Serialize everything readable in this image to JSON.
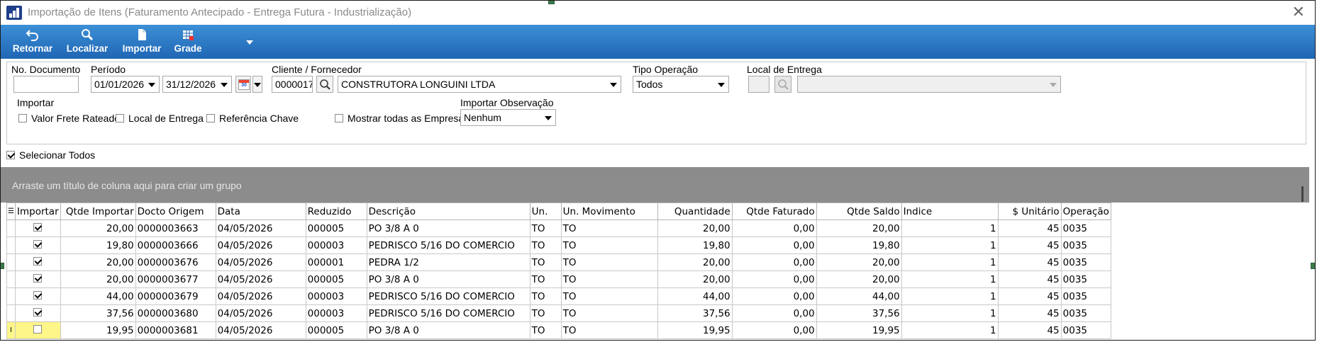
{
  "window": {
    "title": "Importação de Itens (Faturamento Antecipado - Entrega Futura - Industrialização)"
  },
  "toolbar": {
    "retornar": "Retornar",
    "localizar": "Localizar",
    "importar": "Importar",
    "grade": "Grade"
  },
  "filters": {
    "no_documento_label": "No. Documento",
    "no_documento_value": "",
    "periodo_label": "Período",
    "periodo_inicio": "01/01/2026",
    "periodo_fim": "31/12/2026",
    "calendar_icon_text": "30",
    "cliente_label": "Cliente / Fornecedor",
    "cliente_codigo": "0000017",
    "cliente_nome": "CONSTRUTORA LONGUINI LTDA",
    "tipo_operacao_label": "Tipo Operação",
    "tipo_operacao_value": "Todos",
    "local_entrega_label": "Local de Entrega",
    "importar_label": "Importar",
    "valor_frete_rateado": "Valor Frete Rateado",
    "local_de_entrega": "Local de Entrega",
    "referencia_chave": "Referência Chave",
    "mostrar_todas_empresas": "Mostrar todas as Empresas",
    "importar_observacao_label": "Importar Observação",
    "importar_observacao_value": "Nenhum"
  },
  "selecionar_todos": "Selecionar Todos",
  "group_hint": "Arraste um título de coluna aqui para criar um grupo",
  "grid": {
    "columns": [
      "Importar",
      "Qtde Importar",
      "Docto Origem",
      "Data",
      "Reduzido",
      "Descrição",
      "Un.",
      "Un. Movimento",
      "Quantidade",
      "Qtde Faturado",
      "Qtde Saldo",
      "Indice",
      "$ Unitário",
      "Operação"
    ],
    "rows": [
      {
        "importar": true,
        "qtde_importar": "20,00",
        "docto": "0000003663",
        "data": "04/05/2026",
        "reduzido": "000005",
        "descricao": "PO 3/8 A 0",
        "un": "TO",
        "un_mov": "TO",
        "quantidade": "20,00",
        "faturado": "0,00",
        "saldo": "20,00",
        "indice": "1",
        "unitario": "45",
        "operacao": "0035"
      },
      {
        "importar": true,
        "qtde_importar": "19,80",
        "docto": "0000003666",
        "data": "04/05/2026",
        "reduzido": "000003",
        "descricao": "PEDRISCO 5/16 DO COMERCIO",
        "un": "TO",
        "un_mov": "TO",
        "quantidade": "19,80",
        "faturado": "0,00",
        "saldo": "19,80",
        "indice": "1",
        "unitario": "45",
        "operacao": "0035"
      },
      {
        "importar": true,
        "qtde_importar": "20,00",
        "docto": "0000003676",
        "data": "04/05/2026",
        "reduzido": "000001",
        "descricao": "PEDRA 1/2",
        "un": "TO",
        "un_mov": "TO",
        "quantidade": "20,00",
        "faturado": "0,00",
        "saldo": "20,00",
        "indice": "1",
        "unitario": "45",
        "operacao": "0035"
      },
      {
        "importar": true,
        "qtde_importar": "20,00",
        "docto": "0000003677",
        "data": "04/05/2026",
        "reduzido": "000005",
        "descricao": "PO 3/8 A 0",
        "un": "TO",
        "un_mov": "TO",
        "quantidade": "20,00",
        "faturado": "0,00",
        "saldo": "20,00",
        "indice": "1",
        "unitario": "45",
        "operacao": "0035"
      },
      {
        "importar": true,
        "qtde_importar": "44,00",
        "docto": "0000003679",
        "data": "04/05/2026",
        "reduzido": "000003",
        "descricao": "PEDRISCO 5/16 DO COMERCIO",
        "un": "TO",
        "un_mov": "TO",
        "quantidade": "44,00",
        "faturado": "0,00",
        "saldo": "44,00",
        "indice": "1",
        "unitario": "45",
        "operacao": "0035"
      },
      {
        "importar": true,
        "qtde_importar": "37,56",
        "docto": "0000003680",
        "data": "04/05/2026",
        "reduzido": "000003",
        "descricao": "PEDRISCO 5/16 DO COMERCIO",
        "un": "TO",
        "un_mov": "TO",
        "quantidade": "37,56",
        "faturado": "0,00",
        "saldo": "37,56",
        "indice": "1",
        "unitario": "45",
        "operacao": "0035"
      },
      {
        "importar": false,
        "qtde_importar": "19,95",
        "docto": "0000003681",
        "data": "04/05/2026",
        "reduzido": "000005",
        "descricao": "PO 3/8 A 0",
        "un": "TO",
        "un_mov": "TO",
        "quantidade": "19,95",
        "faturado": "0,00",
        "saldo": "19,95",
        "indice": "1",
        "unitario": "45",
        "operacao": "0035"
      }
    ],
    "current_row_indicator": "I"
  },
  "colors": {
    "toolbar_top": "#3d8fd6",
    "toolbar_bottom": "#1f66b4",
    "group_bar": "#8c8c8c",
    "highlight": "#fff68a"
  }
}
